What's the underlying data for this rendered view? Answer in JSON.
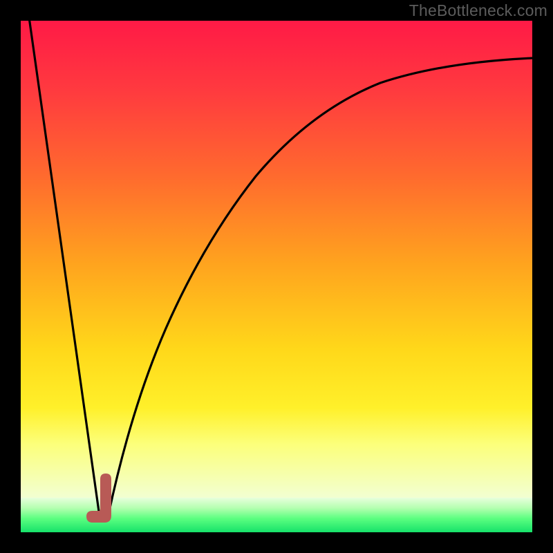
{
  "watermark": "TheBottleneck.com",
  "colors": {
    "frame": "#000000",
    "gradient_top": "#ff1a46",
    "gradient_mid": "#ffd81a",
    "gradient_low": "#16e26a",
    "curve_black": "#000000",
    "marker": "#b85a56"
  },
  "chart_data": {
    "type": "line",
    "title": "",
    "xlabel": "",
    "ylabel": "",
    "xlim": [
      0,
      100
    ],
    "ylim": [
      0,
      100
    ],
    "grid": false,
    "legend": false,
    "note": "Y values are in percent of plot height from bottom (higher = red / worse, lower = green / better). X is percent of plot width.",
    "series": [
      {
        "name": "left-descending-line",
        "x": [
          2,
          15.5
        ],
        "y": [
          100,
          2
        ]
      },
      {
        "name": "right-rising-curve",
        "x": [
          17,
          20,
          25,
          30,
          35,
          40,
          45,
          50,
          55,
          60,
          65,
          70,
          75,
          80,
          85,
          90,
          95,
          100
        ],
        "y": [
          4,
          17,
          33,
          46,
          56,
          64,
          70.5,
          75.5,
          79.5,
          82.5,
          85,
          87,
          88.6,
          89.8,
          90.8,
          91.5,
          92.1,
          92.5
        ]
      },
      {
        "name": "optimum-marker",
        "type": "scatter",
        "x": [
          17.2
        ],
        "y": [
          6
        ],
        "color": "#b85a56",
        "marker": "J-shape"
      }
    ],
    "annotations": []
  }
}
